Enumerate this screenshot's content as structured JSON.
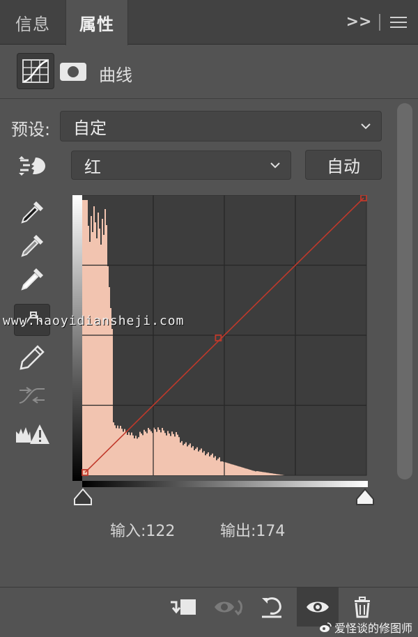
{
  "tabs": [
    {
      "label": "信息"
    },
    {
      "label": "属性"
    }
  ],
  "tab_icons": {
    "expand": "double-chevron-right-icon",
    "menu": "hamburger-menu-icon"
  },
  "adjustment": {
    "title": "曲线",
    "icons": [
      "curves-adjustment-icon",
      "layer-mask-icon"
    ]
  },
  "preset": {
    "label": "预设:",
    "value": "自定"
  },
  "channel": {
    "value": "红"
  },
  "auto_button": "自动",
  "tools": [
    "on-image-adjust-icon",
    "black-point-eyedropper-icon",
    "gray-point-eyedropper-icon",
    "white-point-eyedropper-icon",
    "edit-points-icon",
    "pencil-draw-icon",
    "smooth-curve-icon",
    "clipping-warning-icon"
  ],
  "curve": {
    "points": [
      [
        0,
        0
      ],
      [
        122,
        125
      ],
      [
        255,
        255
      ]
    ],
    "curve_color": "#c0392b",
    "histogram_color": "#f2c4b0"
  },
  "readout": {
    "input": "输入:122",
    "output": "输出:174"
  },
  "bottom_tools": [
    "clip-to-layer-icon",
    "view-previous-state-icon",
    "reset-icon",
    "toggle-visibility-icon",
    "delete-icon"
  ],
  "watermark": "www.haoyidiansheji.com",
  "credit": "爱怪谈的修图师",
  "colors": {
    "panel": "#535353",
    "tabbar": "#424242",
    "graph_bg": "#3d3d3d",
    "accent": "#c0392b"
  }
}
